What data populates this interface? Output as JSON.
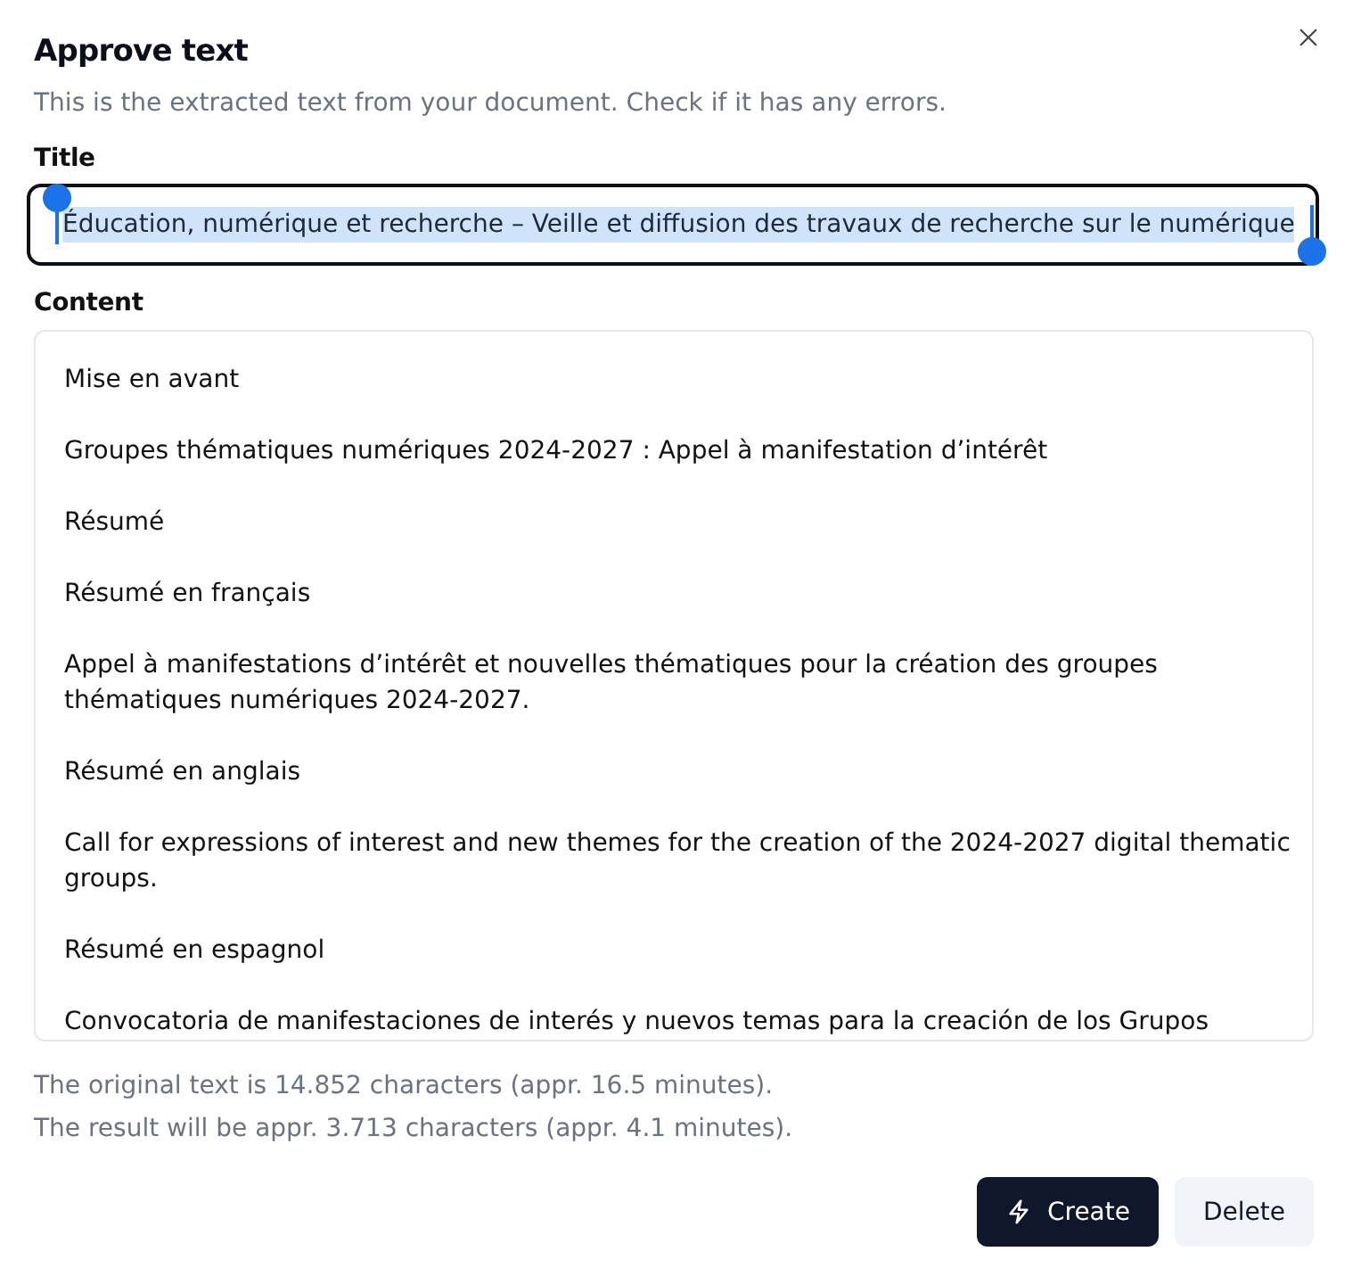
{
  "dialog": {
    "title": "Approve text",
    "description": "This is the extracted text from your document. Check if it has any errors."
  },
  "title_field": {
    "label": "Title",
    "value": "Éducation, numérique et recherche – Veille et diffusion des travaux de recherche sur le numérique",
    "focused": true,
    "text_selected": true
  },
  "content_field": {
    "label": "Content",
    "paragraphs": [
      "Mise en avant",
      "Groupes thématiques numériques 2024-2027 : Appel à manifestation d’intérêt",
      "Résumé",
      "Résumé en français",
      "Appel à manifestations d’intérêt et nouvelles thématiques pour la création des groupes thématiques numériques 2024-2027.",
      "Résumé en anglais",
      "Call for expressions of interest and new themes for the creation of the 2024-2027 digital thematic groups.",
      "Résumé en espagnol",
      "Convocatoria de manifestaciones de interés y nuevos temas para la creación de los Grupos"
    ]
  },
  "notes": [
    "The original text is 14.852 characters (appr. 16.5 minutes).",
    "The result will be appr. 3.713 characters (appr. 4.1 minutes)."
  ],
  "buttons": [
    {
      "label": "Create",
      "kind": "primary"
    },
    {
      "label": "Delete",
      "kind": "secondary"
    }
  ]
}
